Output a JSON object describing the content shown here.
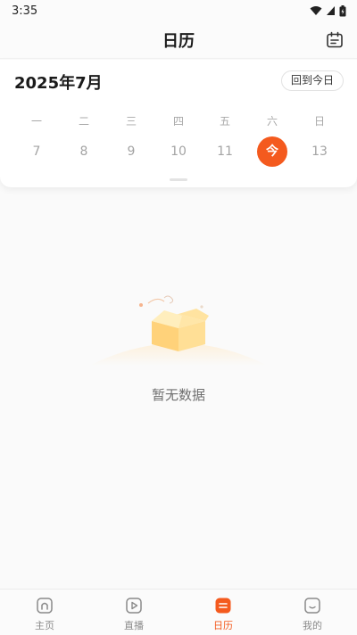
{
  "status_bar": {
    "time": "3:35"
  },
  "header": {
    "title": "日历",
    "calendar_icon": "calendar-icon"
  },
  "calendar": {
    "month_title": "2025年7月",
    "today_button_label": "回到今日",
    "weekdays": [
      "一",
      "二",
      "三",
      "四",
      "五",
      "六",
      "日"
    ],
    "dates": [
      "7",
      "8",
      "9",
      "10",
      "11",
      "今",
      "13"
    ],
    "today_index": 5
  },
  "empty_state": {
    "text": "暂无数据",
    "icon": "empty-box-icon"
  },
  "tabs": [
    {
      "label": "主页",
      "icon": "home-icon"
    },
    {
      "label": "直播",
      "icon": "play-icon"
    },
    {
      "label": "日历",
      "icon": "calendar-tab-icon",
      "active": true
    },
    {
      "label": "我的",
      "icon": "profile-icon"
    }
  ],
  "colors": {
    "accent": "#f45a1e",
    "muted_text": "#a4a4a4"
  }
}
